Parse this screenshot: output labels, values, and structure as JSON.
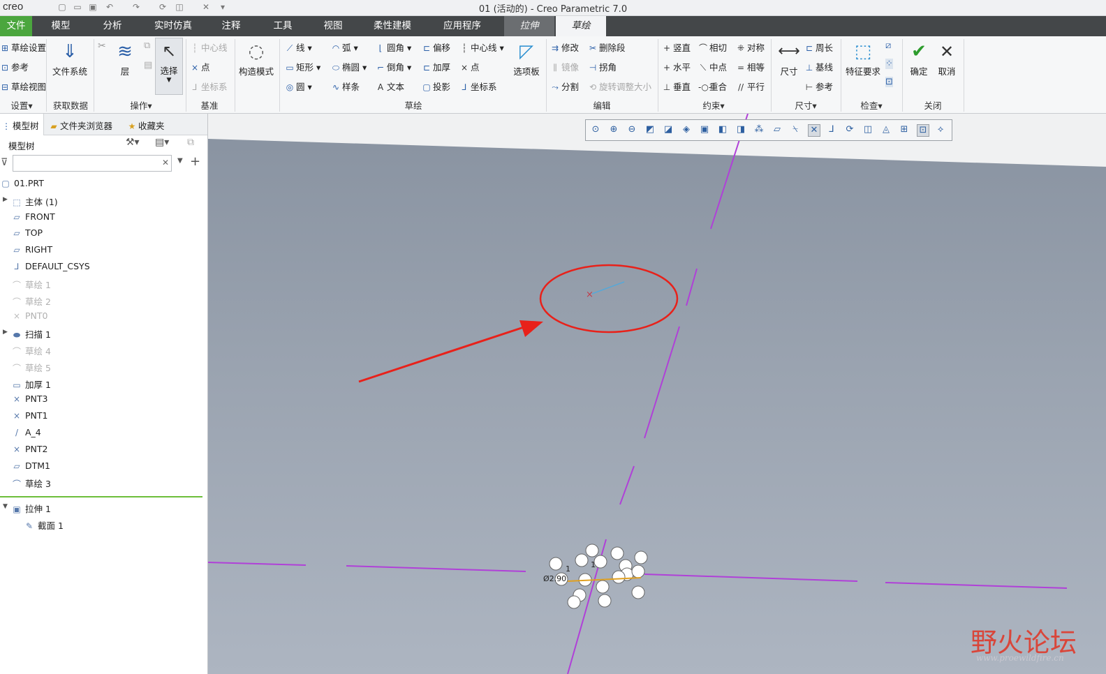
{
  "app": {
    "logo": "creo",
    "window_title": "01 (活动的) - Creo Parametric 7.0"
  },
  "tabs": [
    {
      "label": "文件"
    },
    {
      "label": "模型"
    },
    {
      "label": "分析"
    },
    {
      "label": "实时仿真"
    },
    {
      "label": "注释"
    },
    {
      "label": "工具"
    },
    {
      "label": "视图"
    },
    {
      "label": "柔性建模"
    },
    {
      "label": "应用程序"
    },
    {
      "label": "拉伸"
    },
    {
      "label": "草绘"
    }
  ],
  "ribbon": {
    "setup": {
      "items": [
        "草绘设置",
        "参考",
        "草绘视图"
      ],
      "group": "设置▾"
    },
    "get_data": {
      "label": "文件系统",
      "group": "获取数据"
    },
    "operations": {
      "layer": "层",
      "select": "选择",
      "group": "操作▾"
    },
    "datum": {
      "items": [
        "中心线",
        "点",
        "坐标系"
      ],
      "group": "基准"
    },
    "construction": {
      "label": "构造模式"
    },
    "sketch": {
      "col1": [
        "线",
        "矩形",
        "圆"
      ],
      "col2": [
        "弧",
        "椭圆",
        "样条"
      ],
      "col3": [
        "圆角",
        "倒角",
        "文本"
      ],
      "col4": [
        "偏移",
        "加厚",
        "投影"
      ],
      "col5": [
        "中心线",
        "点",
        "坐标系"
      ],
      "palette": "选项板",
      "group": "草绘"
    },
    "edit": {
      "col1": [
        "修改",
        "镜像",
        "分割"
      ],
      "col2": [
        "删除段",
        "拐角",
        "旋转调整大小"
      ],
      "group": "编辑"
    },
    "constrain": {
      "col1": [
        "竖直",
        "水平",
        "垂直"
      ],
      "col2": [
        "相切",
        "中点",
        "重合"
      ],
      "col3": [
        "对称",
        "相等",
        "平行"
      ],
      "group": "约束▾"
    },
    "dimension": {
      "label": "尺寸",
      "items": [
        "周长",
        "基线",
        "参考"
      ],
      "group": "尺寸▾"
    },
    "inspect": {
      "label": "特征要求",
      "group": "检查▾"
    },
    "close": {
      "ok": "确定",
      "cancel": "取消",
      "group": "关闭"
    }
  },
  "left_panel": {
    "tabs": [
      "模型树",
      "文件夹浏览器",
      "收藏夹"
    ],
    "header": "模型树",
    "search_placeholder": "",
    "tree": [
      {
        "label": "01.PRT",
        "icon": "part-icon",
        "state": "normal"
      },
      {
        "label": "主体 (1)",
        "icon": "body-icon",
        "state": "normal"
      },
      {
        "label": "FRONT",
        "icon": "datum-plane-icon",
        "state": "normal"
      },
      {
        "label": "TOP",
        "icon": "datum-plane-icon",
        "state": "normal"
      },
      {
        "label": "RIGHT",
        "icon": "datum-plane-icon",
        "state": "normal"
      },
      {
        "label": "DEFAULT_CSYS",
        "icon": "csys-icon",
        "state": "normal"
      },
      {
        "label": "草绘 1",
        "icon": "sketch-icon",
        "state": "disabled"
      },
      {
        "label": "草绘 2",
        "icon": "sketch-icon",
        "state": "disabled"
      },
      {
        "label": "PNT0",
        "icon": "point-icon",
        "state": "disabled"
      },
      {
        "label": "扫描 1",
        "icon": "sweep-icon",
        "state": "normal"
      },
      {
        "label": "草绘 4",
        "icon": "sketch-icon",
        "state": "disabled"
      },
      {
        "label": "草绘 5",
        "icon": "sketch-icon",
        "state": "disabled"
      },
      {
        "label": "加厚 1",
        "icon": "thicken-icon",
        "state": "normal"
      },
      {
        "label": "PNT3",
        "icon": "point-icon",
        "state": "normal"
      },
      {
        "label": "PNT1",
        "icon": "point-icon",
        "state": "normal"
      },
      {
        "label": "A_4",
        "icon": "axis-icon",
        "state": "normal"
      },
      {
        "label": "PNT2",
        "icon": "point-icon",
        "state": "normal"
      },
      {
        "label": "DTM1",
        "icon": "datum-plane-icon",
        "state": "normal"
      },
      {
        "label": "草绘 3",
        "icon": "sketch-icon",
        "state": "normal"
      }
    ],
    "insert_tree": [
      {
        "label": "拉伸 1",
        "icon": "extrude-icon"
      },
      {
        "label": "截面 1",
        "icon": "section-icon"
      }
    ]
  },
  "viewport": {
    "dimension_labels": [
      "1",
      "1",
      "Ø2.90"
    ]
  },
  "watermark": {
    "text": "野火论坛",
    "url": "www.proewildfire.cn"
  },
  "colors": {
    "file_tab": "#4ba63e",
    "tabbar": "#444749",
    "annotation": "#e8211a",
    "sketch_line": "#b040d8"
  }
}
